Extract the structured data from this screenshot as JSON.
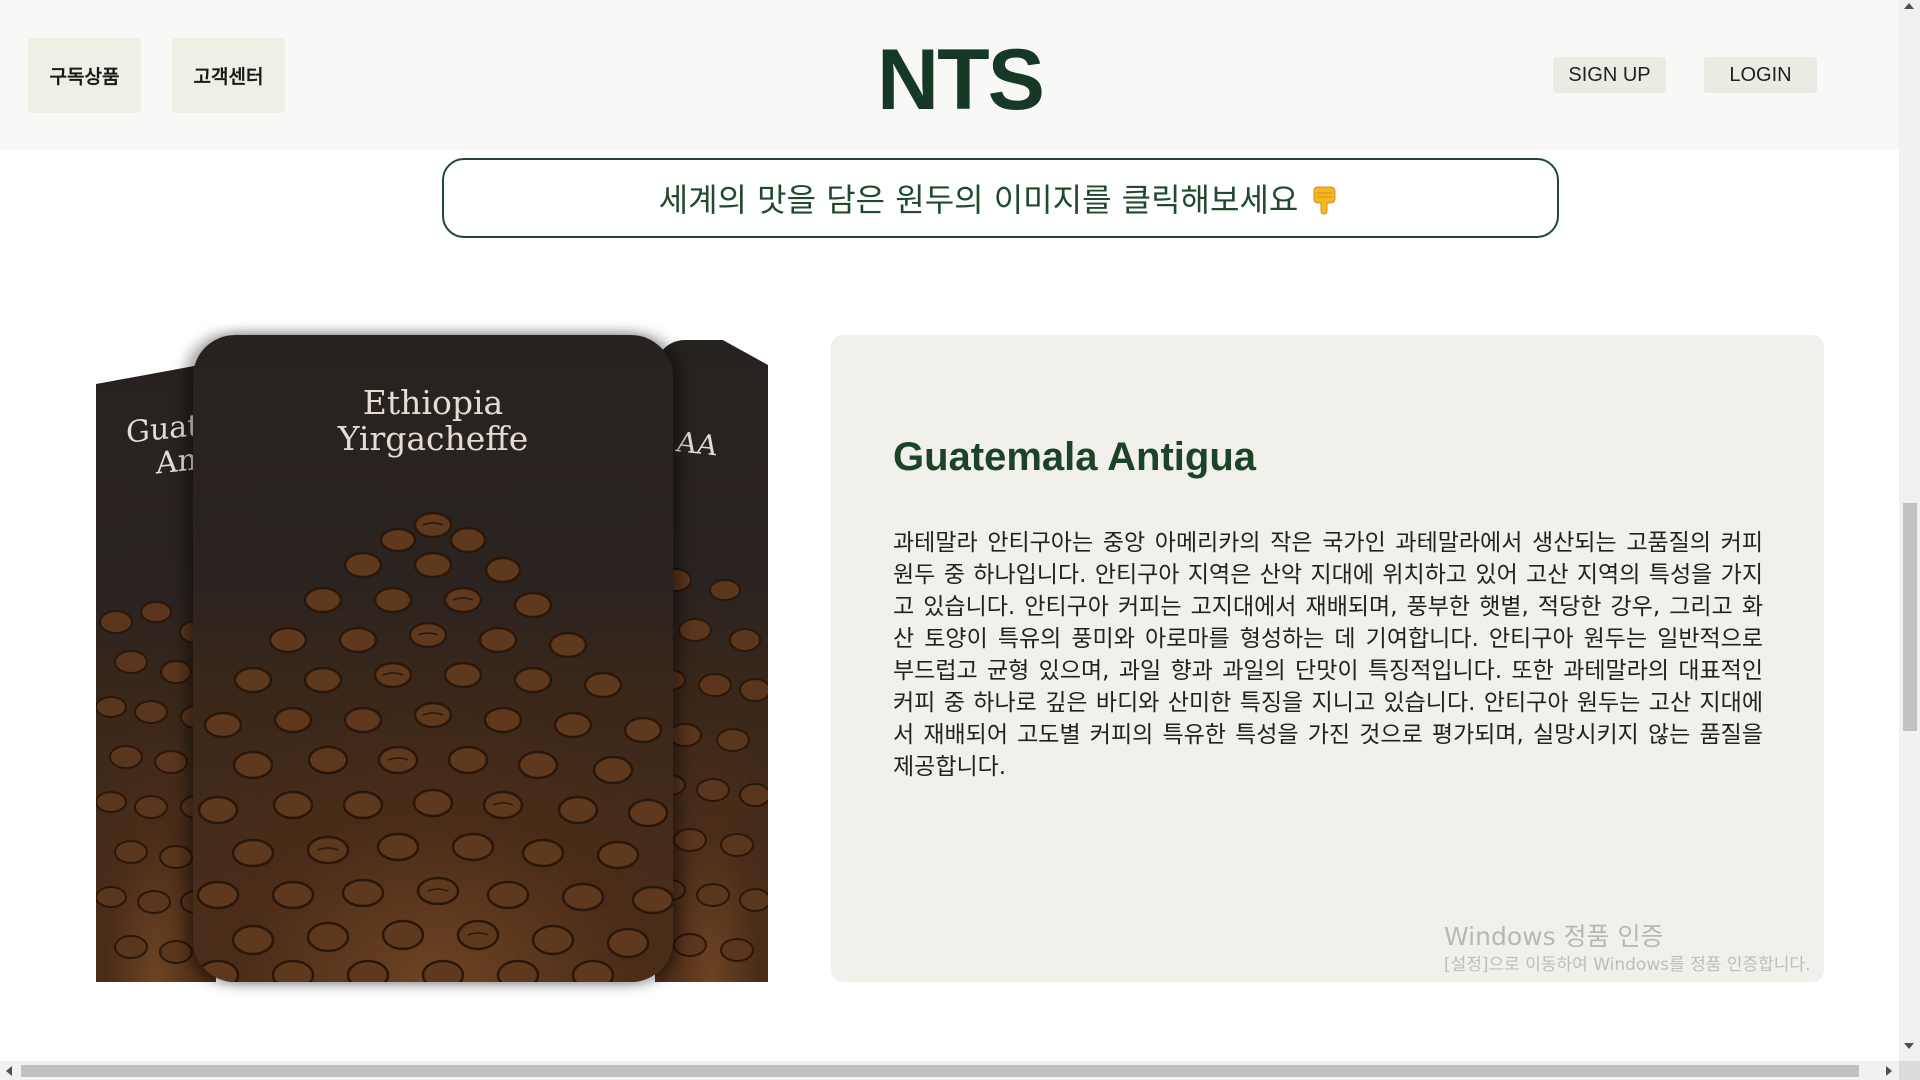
{
  "header": {
    "nav": [
      "구독상품",
      "고객센터"
    ],
    "logo": "NTS",
    "signup_label": "SIGN UP",
    "login_label": "LOGIN"
  },
  "banner": {
    "text": "세계의 맛을 담은 원두의 이미지를 클릭해보세요",
    "icon": "pointing-down-hand-icon"
  },
  "carousel": {
    "left_card_title": "Guatemala Antigua",
    "front_card_title": "Ethiopia Yirgacheffe",
    "right_card_title": "AA",
    "card_image": "coffee-beans-image"
  },
  "detail": {
    "title": "Guatemala Antigua",
    "description": "과테말라 안티구아는 중앙 아메리카의 작은 국가인 과테말라에서 생산되는 고품질의 커피 원두 중 하나입니다. 안티구아 지역은 산악 지대에 위치하고 있어 고산 지역의 특성을 가지고 있습니다. 안티구아 커피는 고지대에서 재배되며, 풍부한 햇볕, 적당한 강우, 그리고 화산 토양이 특유의 풍미와 아로마를 형성하는 데 기여합니다. 안티구아 원두는 일반적으로 부드럽고 균형 있으며, 과일 향과 과일의 단맛이 특징적입니다. 또한 과테말라의 대표적인 커피 중 하나로 깊은 바디와 산미한 특징을 지니고 있습니다. 안티구아 원두는 고산 지대에서 재배되어 고도별 커피의 특유한 특성을 가진 것으로 평가되며, 실망시키지 않는 품질을 제공합니다."
  },
  "watermark": {
    "title": "Windows 정품 인증",
    "subtitle": "[설정]으로 이동하여 Windows를 정품 인증합니다."
  },
  "colors": {
    "brand_green": "#163824",
    "header_bg": "#f8f8f6",
    "panel_bg": "#f1f0eb"
  }
}
